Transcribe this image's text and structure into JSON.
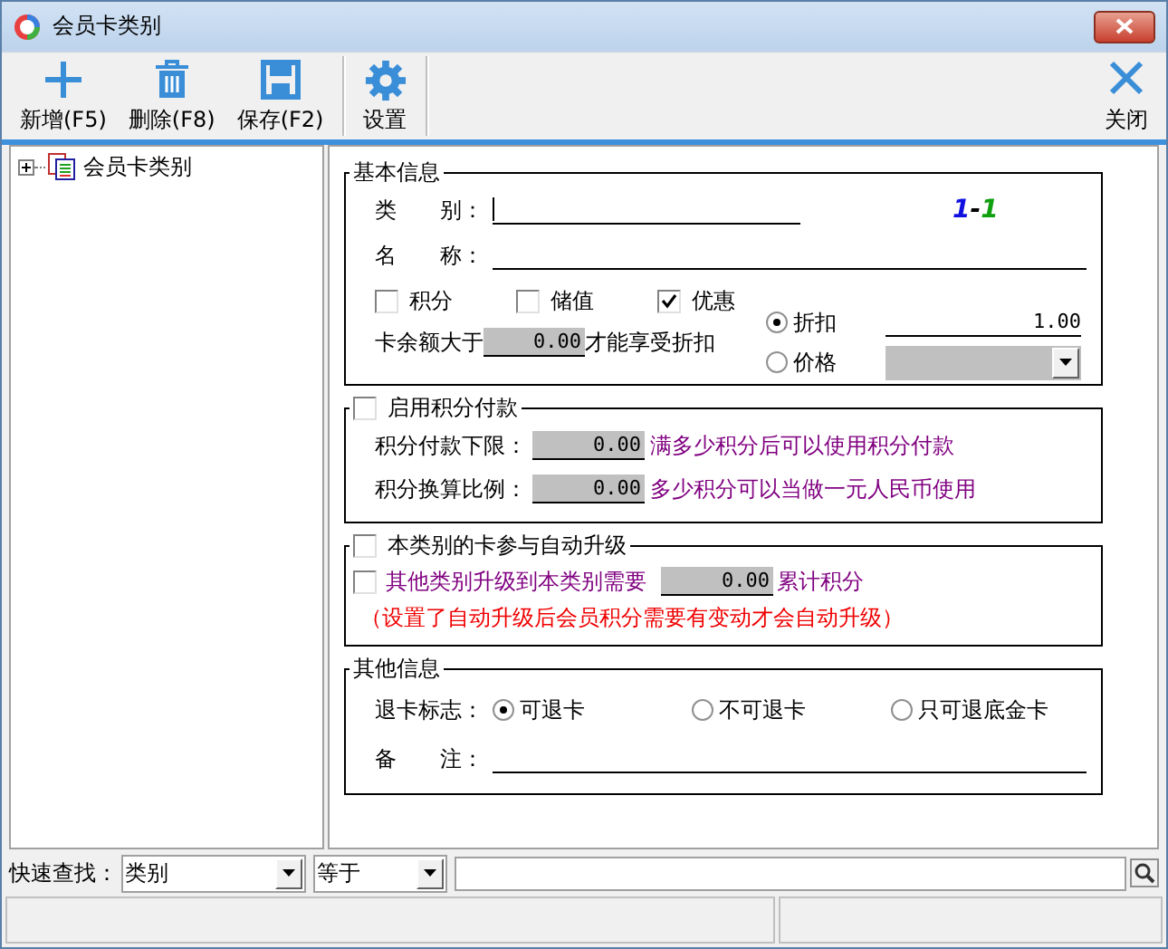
{
  "window": {
    "title": "会员卡类别"
  },
  "toolbar": [
    {
      "kind": "plus",
      "label": "新增(F5)"
    },
    {
      "kind": "trash",
      "label": "删除(F8)"
    },
    {
      "kind": "save",
      "label": "保存(F2)"
    },
    {
      "kind": "gear",
      "label": "设置"
    },
    {
      "kind": "close",
      "label": "关闭"
    }
  ],
  "tree": [
    {
      "label": "会员卡类别",
      "expanded": false
    }
  ],
  "basic_info": {
    "title": "基本信息",
    "category": {
      "label": "类　　别："
    },
    "code": [
      {
        "text": "1",
        "color": "#1010e0"
      },
      {
        "text": "-",
        "color": "#000000"
      },
      {
        "text": "1",
        "color": "#10a010"
      }
    ],
    "name": {
      "label": "名　　称："
    },
    "options": [
      {
        "label": "积分",
        "checked": false
      },
      {
        "label": "储值",
        "checked": false
      },
      {
        "label": "优惠",
        "checked": true
      }
    ],
    "balance": {
      "label": "卡余额大于",
      "value": "0.00",
      "suffix": "才能享受折扣"
    },
    "pricing": [
      {
        "label": "折扣",
        "selected": true,
        "value": "1.00",
        "kind": "text"
      },
      {
        "label": "价格",
        "selected": false,
        "kind": "select"
      }
    ]
  },
  "points_payment": {
    "title": "启用积分付款",
    "checked": false,
    "rows": [
      {
        "label": "积分付款下限：",
        "value": "0.00",
        "hint": "满多少积分后可以使用积分付款"
      },
      {
        "label": "积分换算比例：",
        "value": "0.00",
        "hint": "多少积分可以当做一元人民币使用"
      }
    ]
  },
  "auto_upgrade": {
    "title": "本类别的卡参与自动升级",
    "checked": false,
    "row": {
      "label": "其他类别升级到本类别需要",
      "checked": false,
      "value": "0.00",
      "suffix": "累计积分"
    },
    "note": "（设置了自动升级后会员积分需要有变动才会自动升级）"
  },
  "other_info": {
    "title": "其他信息",
    "refund_label": "退卡标志：",
    "refund_options": [
      {
        "label": "可退卡",
        "selected": true
      },
      {
        "label": "不可退卡",
        "selected": false
      },
      {
        "label": "只可退底金卡",
        "selected": false
      }
    ],
    "remark": {
      "label": "备　　注："
    }
  },
  "quick_search": {
    "label": "快速查找：",
    "field": "类别",
    "operator": "等于"
  }
}
